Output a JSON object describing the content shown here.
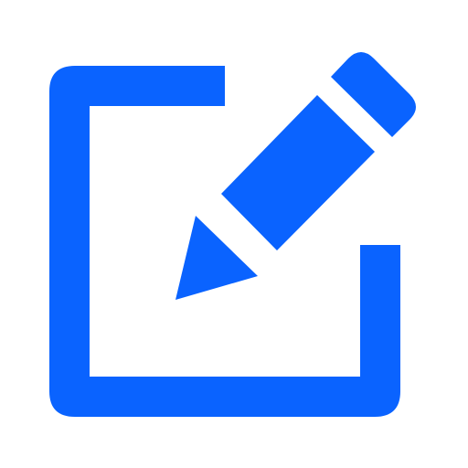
{
  "icon": {
    "name": "edit-icon",
    "color": "#0a63ff",
    "parts": [
      "document-frame",
      "pencil-body",
      "pencil-tip",
      "pencil-eraser"
    ]
  }
}
